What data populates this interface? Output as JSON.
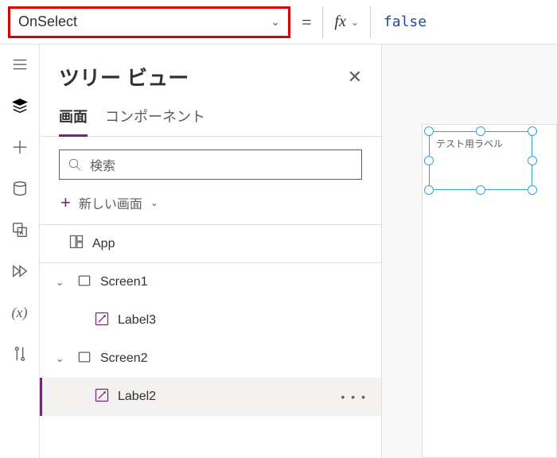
{
  "formula_bar": {
    "property": "OnSelect",
    "fx_label": "fx",
    "value": "false"
  },
  "tree": {
    "title": "ツリー ビュー",
    "tabs": {
      "screens": "画面",
      "components": "コンポーネント"
    },
    "search_placeholder": "検索",
    "new_screen": "新しい画面",
    "app": "App",
    "items": [
      {
        "name": "Screen1",
        "children": [
          {
            "name": "Label3"
          }
        ]
      },
      {
        "name": "Screen2",
        "children": [
          {
            "name": "Label2"
          }
        ]
      }
    ]
  },
  "canvas": {
    "selected_label_text": "テスト用ラベル"
  }
}
